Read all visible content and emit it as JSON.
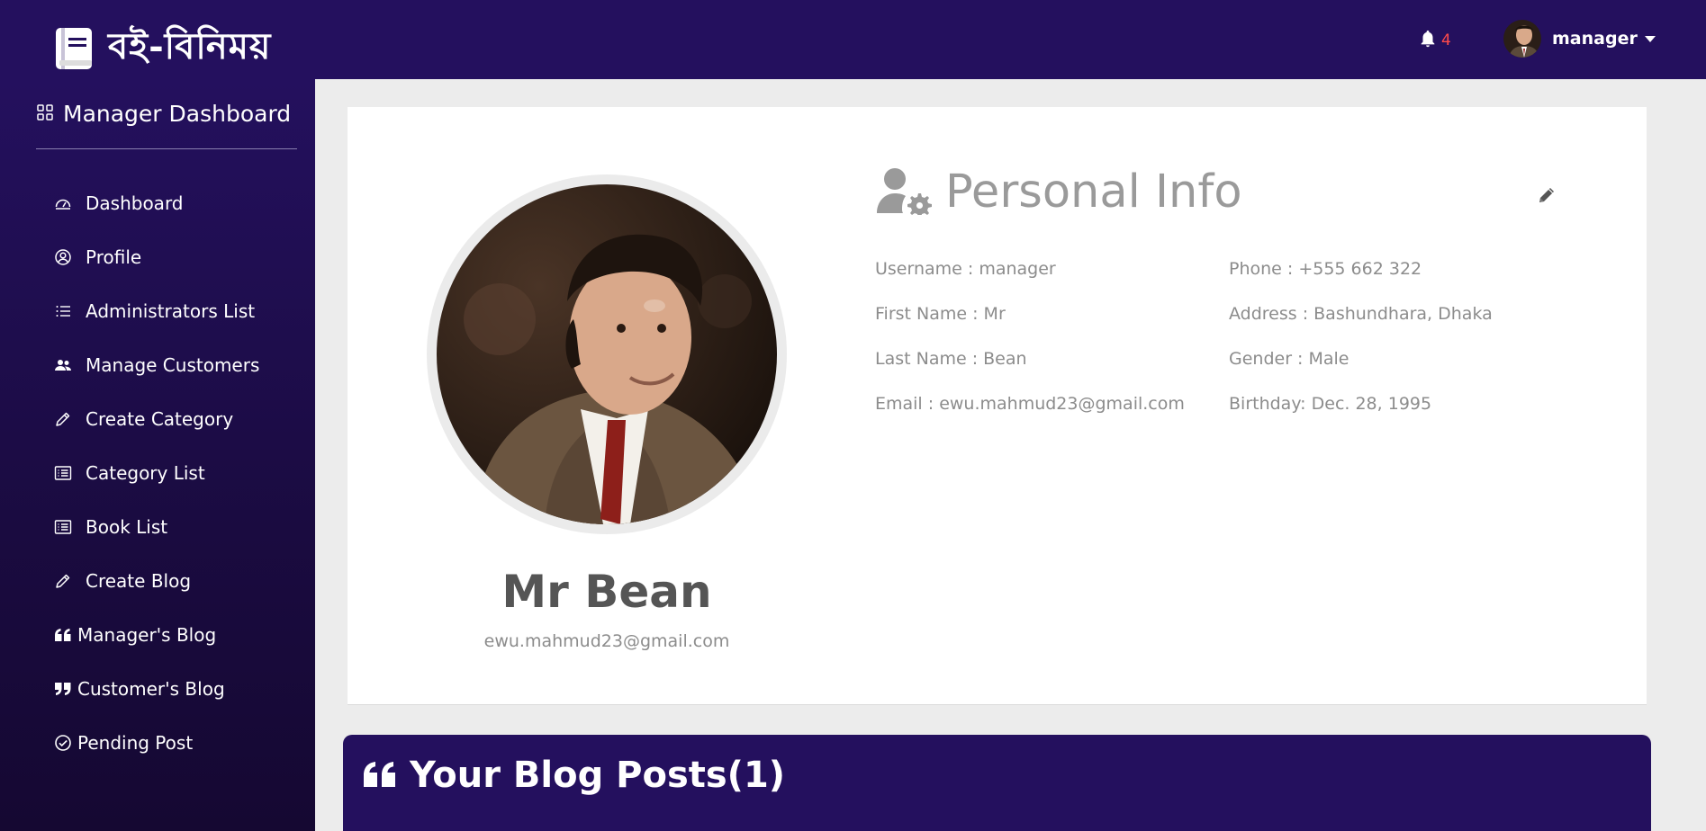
{
  "brand": {
    "name": "বই-বিনিময়"
  },
  "header": {
    "notification_count": "4",
    "user_name": "manager"
  },
  "sidebar": {
    "title": "Manager Dashboard",
    "items": [
      {
        "label": "Dashboard",
        "icon": "speedometer-icon"
      },
      {
        "label": "Profile",
        "icon": "user-circle-icon"
      },
      {
        "label": "Administrators List",
        "icon": "list-icon"
      },
      {
        "label": "Manage Customers",
        "icon": "people-icon"
      },
      {
        "label": "Create Category",
        "icon": "pencil-icon"
      },
      {
        "label": "Category List",
        "icon": "list-box-icon"
      },
      {
        "label": "Book List",
        "icon": "list-box-icon"
      },
      {
        "label": "Create Blog",
        "icon": "pencil-icon"
      },
      {
        "label": "Manager's Blog",
        "icon": "quote-left-icon"
      },
      {
        "label": "Customer's Blog",
        "icon": "quote-right-icon"
      },
      {
        "label": "Pending Post",
        "icon": "check-circle-icon"
      }
    ]
  },
  "profile": {
    "full_name": "Mr Bean",
    "email": "ewu.mahmud23@gmail.com"
  },
  "personal_info": {
    "title": "Personal Info",
    "left": [
      "Username : manager",
      "First Name : Mr",
      "Last Name : Bean",
      "Email : ewu.mahmud23@gmail.com"
    ],
    "right": [
      "Phone : +555 662 322",
      "Address : Bashundhara, Dhaka",
      "Gender : Male",
      "Birthday: Dec. 28, 1995"
    ]
  },
  "blog": {
    "title": "Your Blog Posts(1)"
  },
  "colors": {
    "nav": "#24105e",
    "notif": "#ff4a4a",
    "muted_text": "#8c8c8c"
  }
}
